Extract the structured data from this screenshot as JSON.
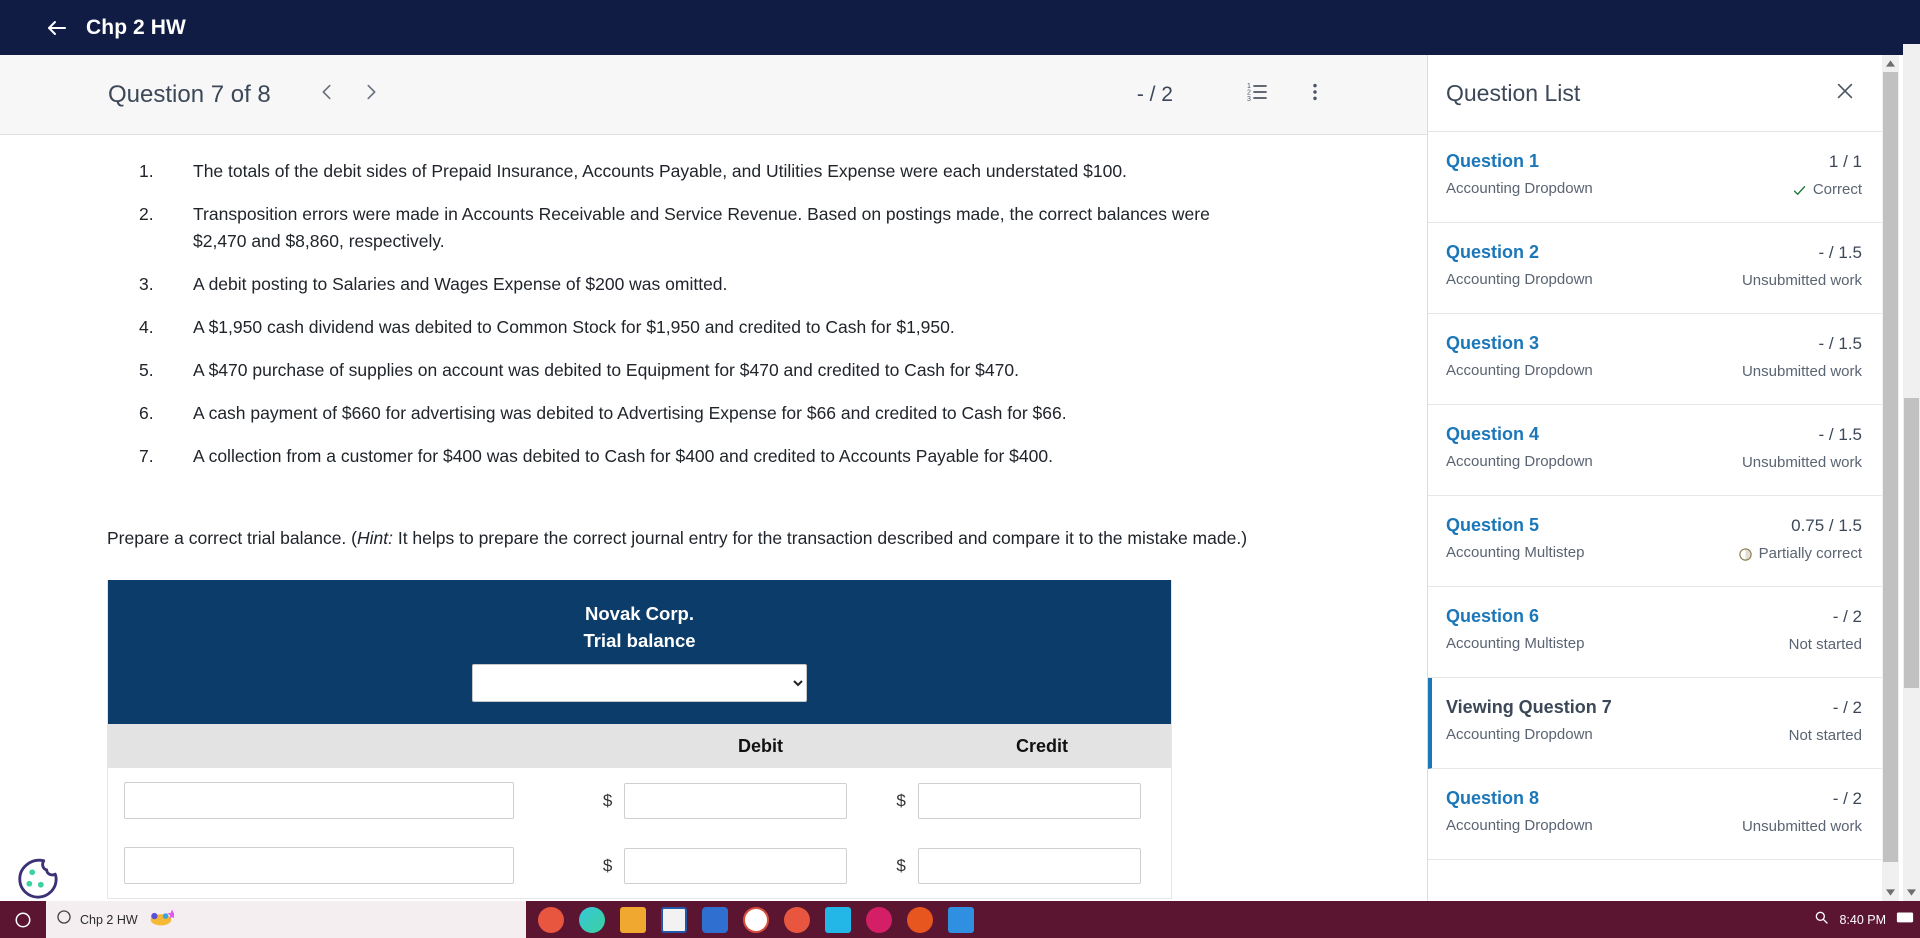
{
  "appbar": {
    "title": "Chp 2 HW",
    "back_icon": "arrow-left-icon"
  },
  "toolbar": {
    "question_counter": "Question 7 of 8",
    "prev_icon": "chevron-left-icon",
    "next_icon": "chevron-right-icon",
    "score": "- / 2",
    "list_icon": "numbered-list-icon",
    "more_icon": "more-vertical-icon"
  },
  "question": {
    "errors": [
      {
        "num": "1.",
        "text": "The totals of the debit sides of Prepaid Insurance, Accounts Payable, and Utilities Expense were each understated $100."
      },
      {
        "num": "2.",
        "text": "Transposition errors were made in Accounts Receivable and Service Revenue. Based on postings made, the correct balances were $2,470 and $8,860, respectively."
      },
      {
        "num": "3.",
        "text": "A debit posting to Salaries and Wages Expense of $200 was omitted."
      },
      {
        "num": "4.",
        "text": "A $1,950 cash dividend was debited to Common Stock for $1,950 and credited to Cash for $1,950."
      },
      {
        "num": "5.",
        "text": "A $470 purchase of supplies on account was debited to Equipment for $470 and credited to Cash for $470."
      },
      {
        "num": "6.",
        "text": "A cash payment of $660 for advertising was debited to Advertising Expense for $66 and credited to Cash for $66."
      },
      {
        "num": "7.",
        "text": "A collection from a customer for $400 was debited to Cash for $400 and credited to Accounts Payable for $400."
      }
    ],
    "prepare_prefix": "Prepare a correct trial balance. (",
    "prepare_hint_label": "Hint:",
    "prepare_suffix": " It helps to prepare the correct journal entry for the transaction described and compare it to the mistake made.)"
  },
  "trial_balance": {
    "company": "Novak Corp.",
    "subtitle": "Trial balance",
    "date_select_value": "",
    "date_select_options": [
      ""
    ],
    "col_account": "",
    "col_debit": "Debit",
    "col_credit": "Credit",
    "currency_symbol": "$",
    "rows": [
      {
        "account": "",
        "debit": "",
        "credit": ""
      },
      {
        "account": "",
        "debit": "",
        "credit": ""
      }
    ]
  },
  "question_list": {
    "title": "Question List",
    "close_icon": "close-icon",
    "items": [
      {
        "name": "Question 1",
        "type": "Accounting Dropdown",
        "score": "1 / 1",
        "status": "Correct",
        "status_icon": "check-icon",
        "active": false
      },
      {
        "name": "Question 2",
        "type": "Accounting Dropdown",
        "score": "- / 1.5",
        "status": "Unsubmitted work",
        "status_icon": "",
        "active": false
      },
      {
        "name": "Question 3",
        "type": "Accounting Dropdown",
        "score": "- / 1.5",
        "status": "Unsubmitted work",
        "status_icon": "",
        "active": false
      },
      {
        "name": "Question 4",
        "type": "Accounting Dropdown",
        "score": "- / 1.5",
        "status": "Unsubmitted work",
        "status_icon": "",
        "active": false
      },
      {
        "name": "Question 5",
        "type": "Accounting Multistep",
        "score": "0.75 / 1.5",
        "status": "Partially correct",
        "status_icon": "half-circle-icon",
        "active": false
      },
      {
        "name": "Question 6",
        "type": "Accounting Multistep",
        "score": "- / 2",
        "status": "Not started",
        "status_icon": "",
        "active": false
      },
      {
        "name": "Viewing Question 7",
        "type": "Accounting Dropdown",
        "score": "- / 2",
        "status": "Not started",
        "status_icon": "",
        "active": true
      },
      {
        "name": "Question 8",
        "type": "Accounting Dropdown",
        "score": "- / 2",
        "status": "Unsubmitted work",
        "status_icon": "",
        "active": false
      }
    ]
  },
  "cookie_widget": {
    "icon": "cookie-icon"
  },
  "taskbar": {
    "start_icon": "start-icon",
    "window_title": "Chp 2 HW",
    "clock": "8:40 PM",
    "apps": [
      "app-icon-1",
      "app-icon-2",
      "app-icon-3",
      "app-icon-4",
      "app-icon-5",
      "app-icon-6",
      "app-icon-7",
      "app-icon-8",
      "app-icon-9",
      "app-icon-10",
      "app-icon-11"
    ]
  },
  "colors": {
    "appbar_navy": "#101c44",
    "table_navy": "#0b3c6a",
    "link_blue": "#1b77b8",
    "correct_green": "#1f7a3d",
    "taskbar": "#5b1531"
  }
}
